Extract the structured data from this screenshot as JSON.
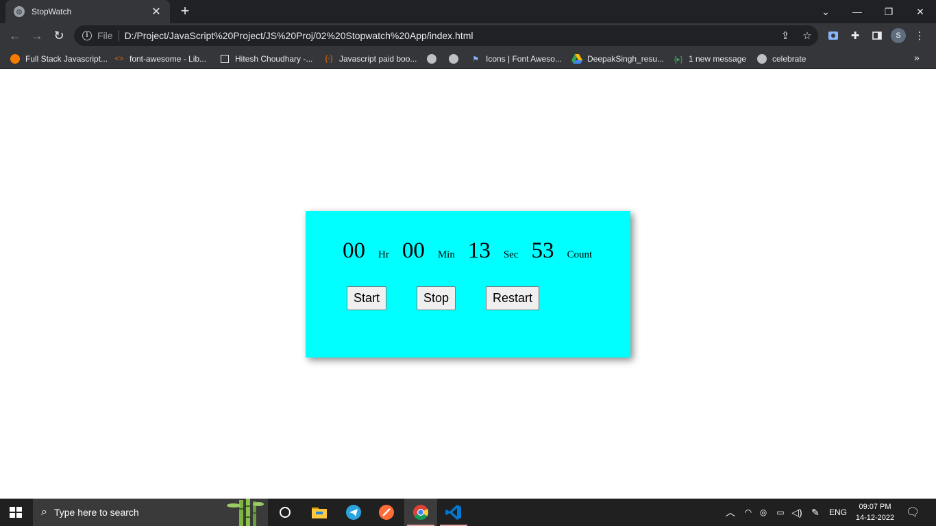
{
  "browser": {
    "tab": {
      "title": "StopWatch"
    },
    "address": {
      "scheme_label": "File",
      "url": "D:/Project/JavaScript%20Project/JS%20Proj/02%20Stopwatch%20App/index.html"
    },
    "profile_initial": "S",
    "bookmarks": [
      {
        "label": "Full Stack Javascript...",
        "icon": "firebase-icon"
      },
      {
        "label": "font-awesome - Lib...",
        "icon": "code-icon"
      },
      {
        "label": "Hitesh Choudhary -...",
        "icon": "page-icon"
      },
      {
        "label": "Javascript paid boo...",
        "icon": "braces-icon"
      },
      {
        "label": "",
        "icon": "globe-icon"
      },
      {
        "label": "",
        "icon": "globe-icon"
      },
      {
        "label": "Icons | Font Aweso...",
        "icon": "flag-icon"
      },
      {
        "label": "DeepakSingh_resu...",
        "icon": "drive-icon"
      },
      {
        "label": "1 new message",
        "icon": "braces-green-icon"
      },
      {
        "label": "celebrate",
        "icon": "globe-icon"
      }
    ]
  },
  "stopwatch": {
    "hours": "00",
    "hours_unit": "Hr",
    "minutes": "00",
    "minutes_unit": "Min",
    "seconds": "13",
    "seconds_unit": "Sec",
    "count": "53",
    "count_unit": "Count",
    "start_label": "Start",
    "stop_label": "Stop",
    "restart_label": "Restart",
    "background_color": "#00ffff"
  },
  "taskbar": {
    "search_placeholder": "Type here to search",
    "language": "ENG",
    "time": "09:07 PM",
    "date": "14-12-2022"
  }
}
